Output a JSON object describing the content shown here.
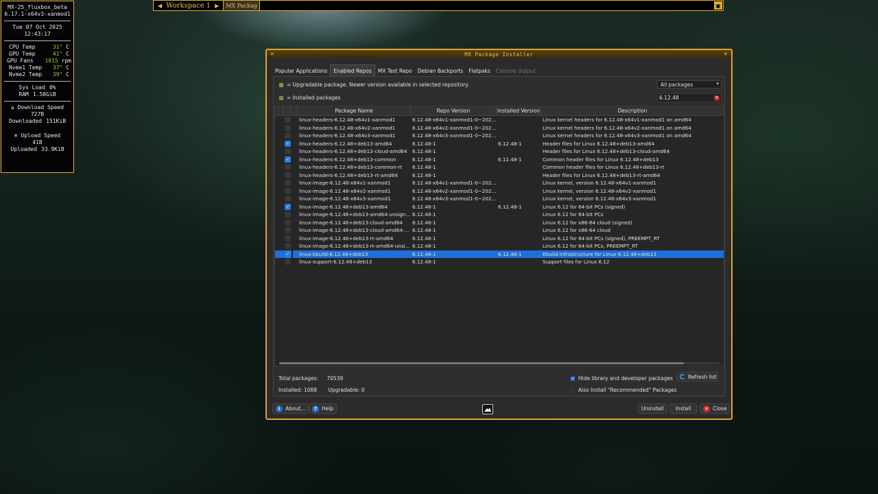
{
  "conky": {
    "host": "MX-25_fluxbox_beta",
    "kernel": "6.17.1-x64v3-xanmod1",
    "date": "Tue 07 Oct 2025",
    "time": "12:43:17",
    "cpu_temp_label": "CPU Temp",
    "cpu_temp": "31°",
    "cpu_unit": "C",
    "gpu_temp_label": "GPU Temp",
    "gpu_temp": "41°",
    "gpu_unit": "C",
    "gpu_fans_label": "GPU Fans",
    "gpu_fans": "1015",
    "gpu_fans_unit": "rpm",
    "nvme1_label": "Nvme1 Temp",
    "nvme1": "37°",
    "nvme1_unit": "C",
    "nvme2_label": "Nvme2 Temp",
    "nvme2": "39°",
    "nvme2_unit": "C",
    "sysload_label": "Sys Load",
    "sysload": "0%",
    "ram_label": "RAM",
    "ram": "1.58GiB",
    "down_label": "⇊ Download Speed",
    "down_speed": "727B",
    "downloaded_label": "Downloaded",
    "downloaded": "151KiB",
    "up_label": "⇈ Upload Speed",
    "up_speed": "41B",
    "uploaded_label": "Uploaded",
    "uploaded": "33.9KiB"
  },
  "wsbar": {
    "prev": "◀",
    "workspace": "Workspace 1",
    "next": "▶",
    "task": "MX Packag"
  },
  "window": {
    "title": "MX Package Installer",
    "tabs": [
      {
        "label": "Popular Applications"
      },
      {
        "label": "Enabled Repos"
      },
      {
        "label": "MX Test Repo"
      },
      {
        "label": "Debian Backports"
      },
      {
        "label": "Flatpaks"
      },
      {
        "label": "Console Output"
      }
    ],
    "legend_upgradable": "= Upgradable package. Newer version available in selected repository.",
    "legend_installed": "= Installed packages",
    "filter_value": "All packages",
    "search_value": "6.12.48",
    "columns": [
      "Package Name",
      "Repo Version",
      "Installed Version",
      "Description"
    ],
    "rows": [
      {
        "name": "linux-headers-6.12.48-x64v1-xanmod1",
        "repo": "6.12.48-x64v1-xanmod1-0~2025...",
        "inst": "",
        "desc": "Linux kernel headers for 6.12.48-x64v1-xanmod1 on amd64"
      },
      {
        "name": "linux-headers-6.12.48-x64v2-xanmod1",
        "repo": "6.12.48-x64v2-xanmod1-0~2025...",
        "inst": "",
        "desc": "Linux kernel headers for 6.12.48-x64v2-xanmod1 on amd64"
      },
      {
        "name": "linux-headers-6.12.48-x64v3-xanmod1",
        "repo": "6.12.48-x64v3-xanmod1-0~2025...",
        "inst": "",
        "desc": "Linux kernel headers for 6.12.48-x64v3-xanmod1 on amd64"
      },
      {
        "name": "linux-headers-6.12.48+deb13-amd64",
        "repo": "6.12.48-1",
        "inst": "6.12.48-1",
        "desc": "Header files for Linux 6.12.48+deb13-amd64"
      },
      {
        "name": "linux-headers-6.12.48+deb13-cloud-amd64",
        "repo": "6.12.48-1",
        "inst": "",
        "desc": "Header files for Linux 6.12.48+deb13-cloud-amd64"
      },
      {
        "name": "linux-headers-6.12.48+deb13-common",
        "repo": "6.12.48-1",
        "inst": "6.12.48-1",
        "desc": "Common header files for Linux 6.12.48+deb13"
      },
      {
        "name": "linux-headers-6.12.48+deb13-common-rt",
        "repo": "6.12.48-1",
        "inst": "",
        "desc": "Common header files for Linux 6.12.48+deb13-rt"
      },
      {
        "name": "linux-headers-6.12.48+deb13-rt-amd64",
        "repo": "6.12.48-1",
        "inst": "",
        "desc": "Header files for Linux 6.12.48+deb13-rt-amd64"
      },
      {
        "name": "linux-image-6.12.48-x64v1-xanmod1",
        "repo": "6.12.48-x64v1-xanmod1-0~2025...",
        "inst": "",
        "desc": "Linux kernel, version 6.12.48-x64v1-xanmod1"
      },
      {
        "name": "linux-image-6.12.48-x64v2-xanmod1",
        "repo": "6.12.48-x64v2-xanmod1-0~2025...",
        "inst": "",
        "desc": "Linux kernel, version 6.12.48-x64v2-xanmod1"
      },
      {
        "name": "linux-image-6.12.48-x64v3-xanmod1",
        "repo": "6.12.48-x64v3-xanmod1-0~2025...",
        "inst": "",
        "desc": "Linux kernel, version 6.12.48-x64v3-xanmod1"
      },
      {
        "name": "linux-image-6.12.48+deb13-amd64",
        "repo": "6.12.48-1",
        "inst": "6.12.48-1",
        "desc": "Linux 6.12 for 64-bit PCs (signed)"
      },
      {
        "name": "linux-image-6.12.48+deb13-amd64-unsigned",
        "repo": "6.12.48-1",
        "inst": "",
        "desc": "Linux 6.12 for 64-bit PCs"
      },
      {
        "name": "linux-image-6.12.48+deb13-cloud-amd64",
        "repo": "6.12.48-1",
        "inst": "",
        "desc": "Linux 6.12 for x86-64 cloud (signed)"
      },
      {
        "name": "linux-image-6.12.48+deb13-cloud-amd64-un...",
        "repo": "6.12.48-1",
        "inst": "",
        "desc": "Linux 6.12 for x86-64 cloud"
      },
      {
        "name": "linux-image-6.12.48+deb13-rt-amd64",
        "repo": "6.12.48-1",
        "inst": "",
        "desc": "Linux 6.12 for 64-bit PCs (signed), PREEMPT_RT"
      },
      {
        "name": "linux-image-6.12.48+deb13-rt-amd64-unsig...",
        "repo": "6.12.48-1",
        "inst": "",
        "desc": "Linux 6.12 for 64-bit PCs, PREEMPT_RT"
      },
      {
        "name": "linux-kbuild-6.12.48+deb13",
        "repo": "6.12.48-1",
        "inst": "6.12.48-1",
        "desc": "Kbuild infrastructure for Linux 6.12.48+deb13"
      },
      {
        "name": "linux-support-6.12.48+deb13",
        "repo": "6.12.48-1",
        "inst": "",
        "desc": "Support files for Linux 6.12"
      }
    ],
    "total_label": "Total packages:",
    "total": "70539",
    "installed_label": "Installed:",
    "installed": "1088",
    "upgradable_label": "Upgradable:",
    "upgradable": "0",
    "hide_lib_label": "Hide library and developer packages",
    "recommended_label": "Also Install \"Recommended\" Packages",
    "refresh_label": "Refresh list",
    "about_label": "About...",
    "help_label": "Help",
    "uninstall_label": "Uninstall",
    "install_label": "Install",
    "close_label": "Close"
  }
}
